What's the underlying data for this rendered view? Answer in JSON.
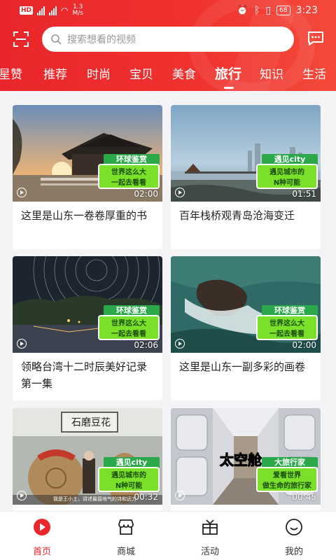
{
  "status_bar": {
    "network_speed": "1.3\nM/s",
    "time": "3:23",
    "battery": "68"
  },
  "search": {
    "placeholder": "搜索想看的视频"
  },
  "tabs": [
    {
      "label": "星赞"
    },
    {
      "label": "推荐"
    },
    {
      "label": "时尚"
    },
    {
      "label": "宝贝"
    },
    {
      "label": "美食"
    },
    {
      "label": "旅行",
      "active": true
    },
    {
      "label": "知识"
    },
    {
      "label": "生活"
    }
  ],
  "videos": [
    {
      "title": "这里是山东一卷卷厚重的书",
      "duration": "02:00",
      "badge_title": "环球鉴赏",
      "badge_line1": "世界这么大",
      "badge_line2": "一起去看看"
    },
    {
      "title": "百年栈桥观青岛沧海变迁",
      "duration": "01:51",
      "badge_title": "遇见city",
      "badge_line1": "遇见城市的",
      "badge_line2": "N种可能"
    },
    {
      "title": "领略台湾十二时辰美好记录第一集",
      "duration": "02:06",
      "badge_title": "环球鉴赏",
      "badge_line1": "世界这么大",
      "badge_line2": "一起去看看"
    },
    {
      "title": "这里是山东一副多彩的画卷",
      "duration": "02:00",
      "badge_title": "环球鉴赏",
      "badge_line1": "世界这么大",
      "badge_line2": "一起去看看"
    },
    {
      "title": "",
      "duration": "00:32",
      "badge_title": "遇见city",
      "badge_line1": "遇见城市的",
      "badge_line2": "N种可能",
      "sign_text": "石磨豆花",
      "subtitle_text": "我是王小土，讲述最接地气的诗和远方"
    },
    {
      "title": "",
      "duration": "00:45",
      "badge_title": "大旅行家",
      "badge_line1": "爱看世界",
      "badge_line2": "做生命的旅行家",
      "overlay_text": "太空舱"
    }
  ],
  "bottom_nav": [
    {
      "label": "首页",
      "icon": "home-play-icon",
      "active": true
    },
    {
      "label": "商城",
      "icon": "shop-icon"
    },
    {
      "label": "活动",
      "icon": "gift-icon"
    },
    {
      "label": "我的",
      "icon": "smiley-icon"
    }
  ],
  "colors": {
    "brand_red": "#e8262b",
    "badge_green": "#2aa84a",
    "badge_lime": "#7be02a"
  }
}
